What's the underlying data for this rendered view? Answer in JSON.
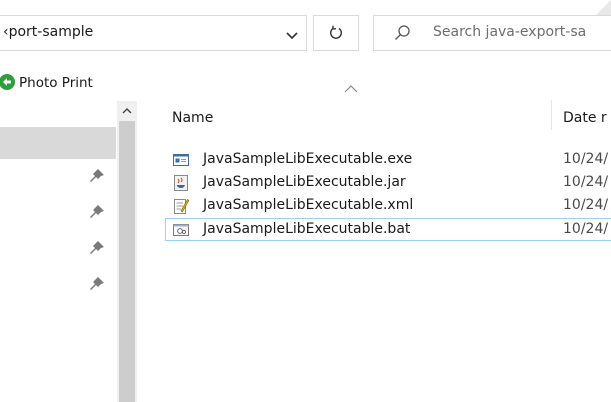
{
  "address_bar": {
    "path_text": "‹port-sample"
  },
  "search": {
    "placeholder": "Search java-export-sa"
  },
  "favorites_bar": {
    "items": [
      {
        "label": "Photo Print"
      }
    ]
  },
  "columns": {
    "name": "Name",
    "date": "Date r"
  },
  "files": [
    {
      "name": "JavaSampleLibExecutable.exe",
      "date": "10/24/",
      "icon": "exe-icon"
    },
    {
      "name": "JavaSampleLibExecutable.jar",
      "date": "10/24/",
      "icon": "jar-icon"
    },
    {
      "name": "JavaSampleLibExecutable.xml",
      "date": "10/24/",
      "icon": "xml-icon"
    },
    {
      "name": "JavaSampleLibExecutable.bat",
      "date": "10/24/",
      "icon": "bat-icon"
    }
  ],
  "colors": {
    "selection_border": "#99d1ff",
    "nav_selected": "#d9d9d9",
    "scrollbar_thumb": "#cdcdcd"
  }
}
